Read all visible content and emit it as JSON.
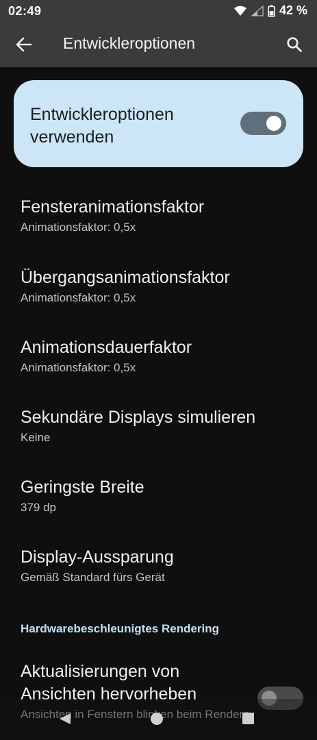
{
  "status_bar": {
    "time": "02:49",
    "battery_percent": "42 %",
    "icons": [
      "wifi-icon",
      "signal-icon",
      "battery-icon"
    ]
  },
  "app_bar": {
    "title": "Entwickleroptionen",
    "back_icon": "arrow-back-icon",
    "search_icon": "search-icon"
  },
  "master_switch": {
    "label": "Entwickleroptionen verwenden",
    "checked": true
  },
  "items": [
    {
      "title": "Fensteranimationsfaktor",
      "summary": "Animationsfaktor: 0,5x"
    },
    {
      "title": "Übergangsanimationsfaktor",
      "summary": "Animationsfaktor: 0,5x"
    },
    {
      "title": "Animationsdauerfaktor",
      "summary": "Animationsfaktor: 0,5x"
    },
    {
      "title": "Sekundäre Displays simulieren",
      "summary": "Keine"
    },
    {
      "title": "Geringste Breite",
      "summary": "379 dp"
    },
    {
      "title": "Display-Aussparung",
      "summary": "Gemäß Standard fürs Gerät"
    }
  ],
  "section": {
    "header": "Hardwarebeschleunigtes Rendering"
  },
  "switch_item": {
    "title": "Aktualisierungen von Ansichten hervorheben",
    "summary": "Ansichten in Fenstern blinken beim Rendern",
    "checked": false
  },
  "colors": {
    "background": "#0f0f0f",
    "app_bar": "#3b3b3b",
    "card": "#cde6f7",
    "accent_header": "#bfe0f7"
  },
  "nav_bar": {
    "icons": [
      "nav-back-icon",
      "nav-home-icon",
      "nav-recents-icon"
    ]
  }
}
